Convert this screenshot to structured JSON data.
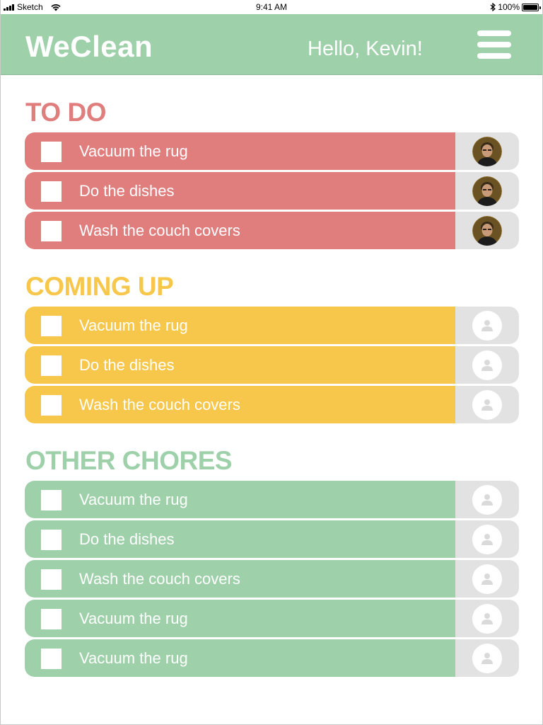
{
  "status_bar": {
    "carrier": "Sketch",
    "time": "9:41 AM",
    "battery": "100%"
  },
  "header": {
    "app_title": "WeClean",
    "greeting": "Hello, Kevin!",
    "menu_icon": "hamburger-menu-icon"
  },
  "colors": {
    "header_bg": "#9ed0aa",
    "todo": "#e07d7d",
    "coming_up": "#f6c74a",
    "other": "#9ed0aa",
    "assignee_bg": "#e2e2e2"
  },
  "sections": [
    {
      "title": "TO DO",
      "color": "#e07d7d",
      "tasks": [
        {
          "label": "Vacuum the rug",
          "checked": false,
          "assignee": "user-photo"
        },
        {
          "label": "Do the dishes",
          "checked": false,
          "assignee": "user-photo"
        },
        {
          "label": "Wash the couch covers",
          "checked": false,
          "assignee": "user-photo"
        }
      ]
    },
    {
      "title": "COMING UP",
      "color": "#f6c74a",
      "tasks": [
        {
          "label": "Vacuum the rug",
          "checked": false,
          "assignee": "unassigned"
        },
        {
          "label": "Do the dishes",
          "checked": false,
          "assignee": "unassigned"
        },
        {
          "label": "Wash the couch covers",
          "checked": false,
          "assignee": "unassigned"
        }
      ]
    },
    {
      "title": "OTHER CHORES",
      "color": "#9ed0aa",
      "tasks": [
        {
          "label": "Vacuum the rug",
          "checked": false,
          "assignee": "unassigned"
        },
        {
          "label": "Do the dishes",
          "checked": false,
          "assignee": "unassigned"
        },
        {
          "label": "Wash the couch covers",
          "checked": false,
          "assignee": "unassigned"
        },
        {
          "label": "Vacuum the rug",
          "checked": false,
          "assignee": "unassigned"
        },
        {
          "label": "Vacuum the rug",
          "checked": false,
          "assignee": "unassigned"
        }
      ]
    }
  ]
}
